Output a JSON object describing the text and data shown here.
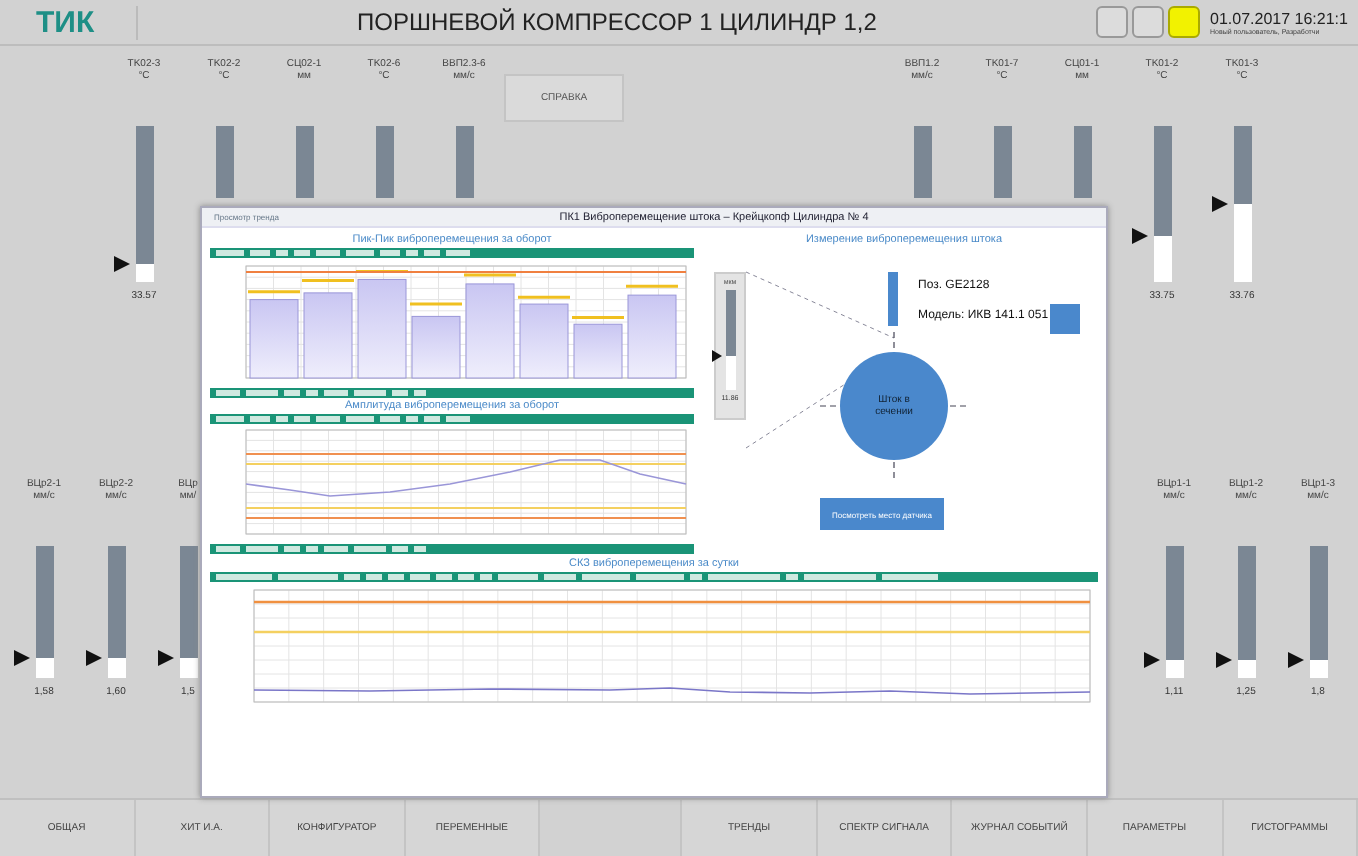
{
  "header": {
    "logo": "ТИК",
    "title": "ПОРШНЕВОЙ КОМПРЕССОР 1 ЦИЛИНДР 1,2",
    "indicators": [
      {
        "on": false
      },
      {
        "on": false
      },
      {
        "on": true
      }
    ],
    "datetime": "01.07.2017 16:21:1",
    "user": "Новый пользователь, Разработчи"
  },
  "help_button": "СПРАВКА",
  "top_left_gauges": [
    {
      "tag": "TK02-3",
      "unit": "°C",
      "level": 0.12,
      "reading": "33.57"
    },
    {
      "tag": "TK02-2",
      "unit": "°C"
    },
    {
      "tag": "СЦ02-1",
      "unit": "мм"
    },
    {
      "tag": "TK02-6",
      "unit": "°C"
    },
    {
      "tag": "ВВП2.3-6",
      "unit": "мм/с"
    }
  ],
  "top_right_gauges": [
    {
      "tag": "ВВП1.2",
      "unit": "мм/с"
    },
    {
      "tag": "TK01-7",
      "unit": "°C"
    },
    {
      "tag": "СЦ01-1",
      "unit": "мм"
    },
    {
      "tag": "TK01-2",
      "unit": "°C",
      "level": 0.3,
      "reading": "33.75"
    },
    {
      "tag": "TK01-3",
      "unit": "°C",
      "level": 0.5,
      "reading": "33.76"
    }
  ],
  "mid_left_gauges": [
    {
      "tag": "ВЦр2-1",
      "unit": "мм/с",
      "level": 0.15,
      "reading": "1,58"
    },
    {
      "tag": "ВЦр2-2",
      "unit": "мм/с",
      "level": 0.15,
      "reading": "1,60"
    },
    {
      "tag": "ВЦр",
      "unit": "мм/",
      "level": 0.15,
      "reading": "1,5"
    }
  ],
  "mid_right_gauges": [
    {
      "tag": "ВЦр1-1",
      "unit": "мм/с",
      "level": 0.13,
      "reading": "1,11"
    },
    {
      "tag": "ВЦр1-2",
      "unit": "мм/с",
      "level": 0.14,
      "reading": "1,25"
    },
    {
      "tag": "ВЦр1-3",
      "unit": "мм/с",
      "level": 0.14,
      "reading": "1,8"
    }
  ],
  "popup": {
    "caption": "Просмотр тренда",
    "title": "ПК1 Виброперемещение штока – Крейцкопф Цилиндра № 4",
    "bar_chart_title": "Пик-Пик виброперемещения за оборот",
    "line_chart_title": "Амплитуда виброперемещения за оборот",
    "sensor_title": "Измерение виброперемещения штока",
    "sensor_gauge": {
      "unit": "мкм",
      "level": 0.35,
      "reading": "11.86"
    },
    "position": "Поз. GE2128",
    "model": "Модель: ИКВ 141.1 051",
    "rod_label": "Шток в сечении",
    "sensor_button": "Посмотреть место датчика",
    "trend_title": "СКЗ виброперемещения за сутки"
  },
  "nav_left": [
    "ОБЩАЯ",
    "ХИТ И.А.",
    "КОНФИГУРАТОР",
    "ПЕРЕМЕННЫЕ"
  ],
  "nav_right": [
    "ТРЕНДЫ",
    "СПЕКТР СИГНАЛА",
    "ЖУРНАЛ СОБЫТИЙ",
    "ПАРАМЕТРЫ",
    "ГИСТОГРАММЫ"
  ]
}
